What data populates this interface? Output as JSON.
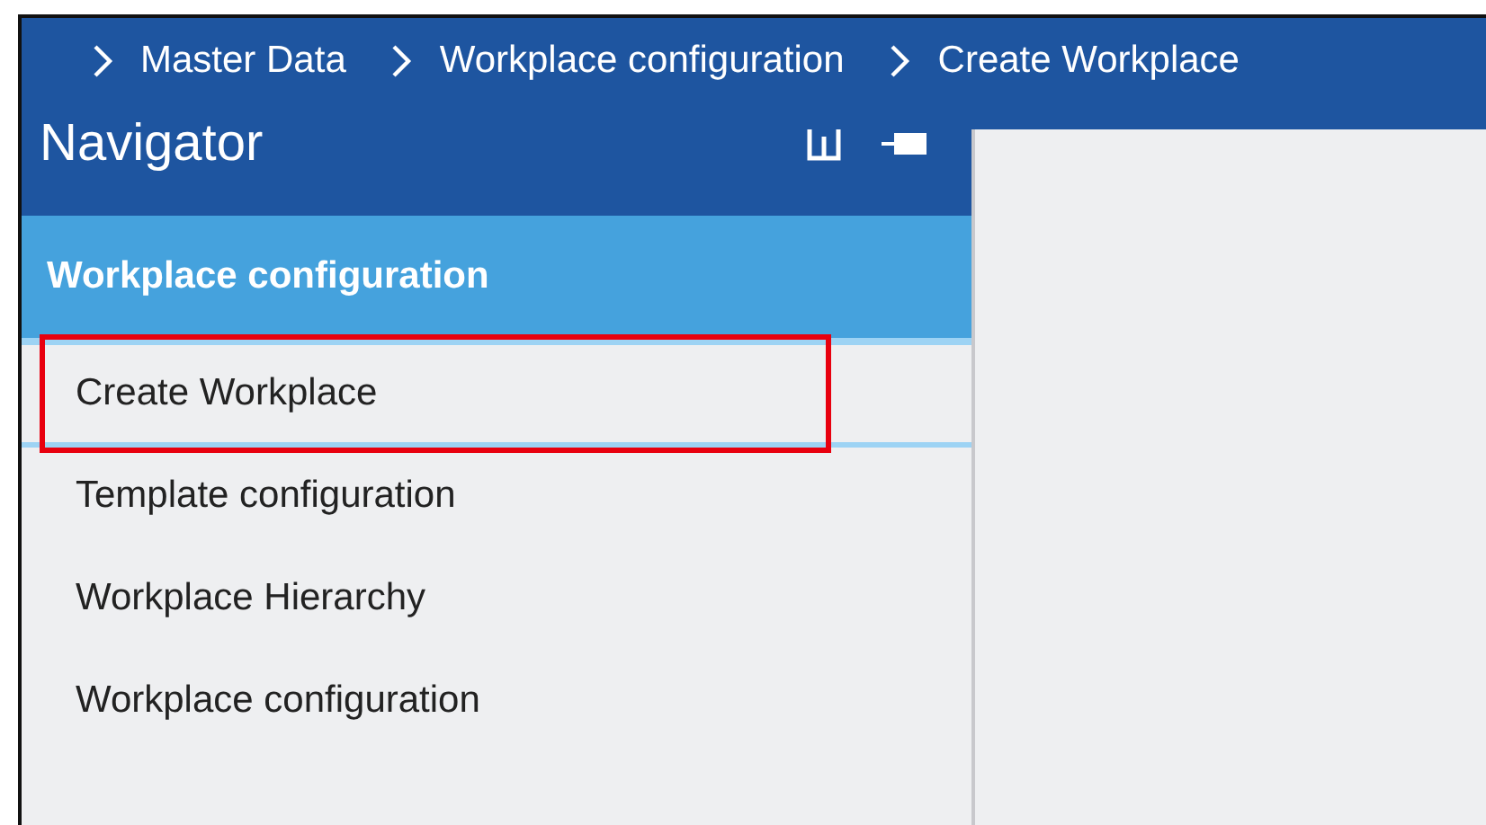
{
  "breadcrumb": [
    {
      "label": "Master Data"
    },
    {
      "label": "Workplace configuration"
    },
    {
      "label": "Create Workplace"
    }
  ],
  "navigator": {
    "title": "Navigator",
    "section": "Workplace configuration",
    "items": [
      {
        "label": "Create Workplace",
        "selected": true,
        "highlighted": true
      },
      {
        "label": "Template configuration",
        "selected": false,
        "highlighted": false
      },
      {
        "label": "Workplace Hierarchy",
        "selected": false,
        "highlighted": false
      },
      {
        "label": "Workplace configuration",
        "selected": false,
        "highlighted": false
      }
    ]
  }
}
